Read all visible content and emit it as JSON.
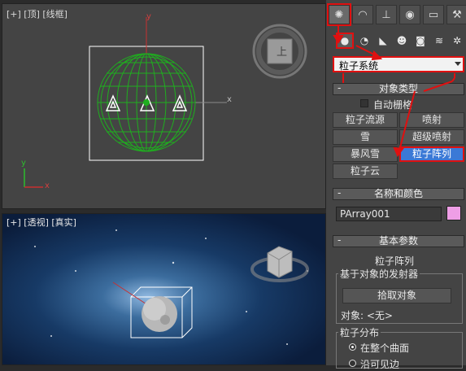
{
  "viewports": {
    "top": {
      "label": "[+] [顶] [线框]",
      "axis_x": "x",
      "axis_y": "y",
      "axis_x_corner": "x",
      "axis_y_corner": "y"
    },
    "persp": {
      "label": "[+] [透视] [真实]"
    }
  },
  "viewcube": {
    "face_top": "上"
  },
  "panel": {
    "tabs": [
      "create-icon",
      "modify-icon",
      "hierarchy-icon",
      "motion-icon",
      "display-icon",
      "utilities-icon"
    ],
    "subtabs": [
      "geometry-icon",
      "shapes-icon",
      "lights-icon",
      "cameras-icon",
      "helpers-icon",
      "spacewarps-icon",
      "systems-icon"
    ],
    "category": "粒子系统",
    "object_type": {
      "title": "对象类型",
      "autogrid": "自动栅格",
      "buttons": [
        "粒子流源",
        "喷射",
        "雪",
        "超级喷射",
        "暴风雪",
        "粒子阵列",
        "粒子云"
      ]
    },
    "name_color": {
      "title": "名称和颜色",
      "name_value": "PArray001",
      "swatch_color": "#ee9ee6"
    },
    "basic_params": {
      "title": "基本参数",
      "subtitle": "粒子阵列",
      "emitter_group": "基于对象的发射器",
      "pick_button": "拾取对象",
      "object_label": "对象: <无>",
      "distribution_group": "粒子分布",
      "option1": "在整个曲面",
      "option2": "沿可见边"
    }
  },
  "colors": {
    "highlight": "#e01010",
    "selected": "#3b79d6"
  }
}
